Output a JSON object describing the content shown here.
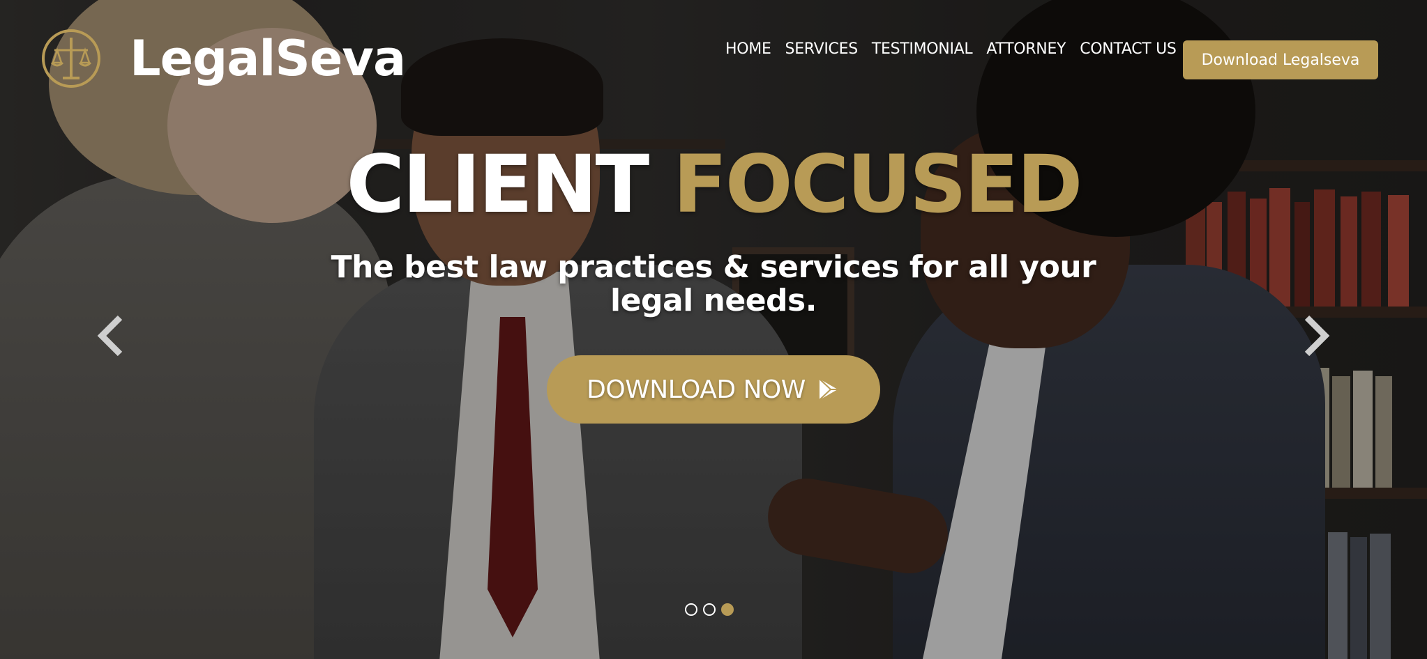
{
  "brand": {
    "name": "LegalSeva"
  },
  "nav": {
    "items": [
      {
        "label": "HOME"
      },
      {
        "label": "SERVICES"
      },
      {
        "label": "TESTIMONIAL"
      },
      {
        "label": "ATTORNEY"
      },
      {
        "label": "CONTACT US"
      }
    ],
    "cta_label": "Download Legalseva"
  },
  "hero": {
    "headline_white": "CLIENT",
    "headline_gold": "FOCUSED",
    "subtitle": "The best law practices & services for all your legal needs.",
    "button_label": "DOWNLOAD NOW",
    "prev_icon": "chevron-left-icon",
    "next_icon": "chevron-right-icon"
  },
  "carousel": {
    "slides": 3,
    "active_index": 3
  },
  "colors": {
    "accent": "#b89b56",
    "text": "#ffffff"
  }
}
